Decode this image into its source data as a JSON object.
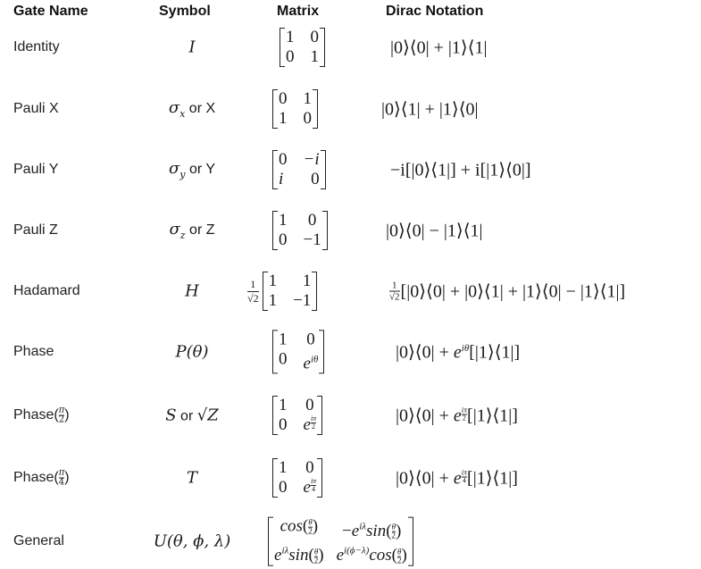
{
  "headers": {
    "gate_name": "Gate Name",
    "symbol": "Symbol",
    "matrix": "Matrix",
    "dirac": "Dirac Notation"
  },
  "gates": [
    {
      "name": "Identity",
      "symbol": "I",
      "matrix": [
        [
          "1",
          "0"
        ],
        [
          "0",
          "1"
        ]
      ],
      "dirac": "|0⟩⟨0| + |1⟩⟨1|"
    },
    {
      "name": "Pauli X",
      "symbol_math": "σₓ",
      "symbol_text": " or X",
      "matrix": [
        [
          "0",
          "1"
        ],
        [
          "1",
          "0"
        ]
      ],
      "dirac": "|0⟩⟨1| + |1⟩⟨0|"
    },
    {
      "name": "Pauli Y",
      "symbol_math": "σᵧ",
      "symbol_text": " or Y",
      "matrix": [
        [
          "0",
          "−i"
        ],
        [
          "i",
          "0"
        ]
      ],
      "dirac": "−i[|0⟩⟨1|] + i[|1⟩⟨0|]"
    },
    {
      "name": "Pauli Z",
      "symbol_math": "σ_z",
      "symbol_text": " or Z",
      "matrix": [
        [
          "1",
          "0"
        ],
        [
          "0",
          "−1"
        ]
      ],
      "dirac": "|0⟩⟨0| − |1⟩⟨1|"
    },
    {
      "name": "Hadamard",
      "symbol": "H",
      "matrix_prefactor": "1/√2",
      "matrix": [
        [
          "1",
          "1"
        ],
        [
          "1",
          "−1"
        ]
      ],
      "dirac_prefactor": "1/√2",
      "dirac": "[|0⟩⟨0| + |0⟩⟨1| + |1⟩⟨0| − |1⟩⟨1|]"
    },
    {
      "name": "Phase",
      "symbol": "P(θ)",
      "matrix": [
        [
          "1",
          "0"
        ],
        [
          "0",
          "e^{iθ}"
        ]
      ],
      "dirac": "|0⟩⟨0| + e^{iθ}[|1⟩⟨1|]"
    },
    {
      "name": "Phase(π/2)",
      "symbol_math": "S",
      "symbol_text": " or ",
      "symbol_math2": "√Z",
      "matrix": [
        [
          "1",
          "0"
        ],
        [
          "0",
          "e^{iπ/2}"
        ]
      ],
      "dirac": "|0⟩⟨0| + e^{iπ/2}[|1⟩⟨1|]"
    },
    {
      "name": "Phase(π/4)",
      "symbol": "T",
      "matrix": [
        [
          "1",
          "0"
        ],
        [
          "0",
          "e^{iπ/4}"
        ]
      ],
      "dirac": "|0⟩⟨0| + e^{iπ/4}[|1⟩⟨1|]"
    },
    {
      "name": "General",
      "symbol": "U(θ, ϕ, λ)",
      "matrix": [
        [
          "cos(θ/2)",
          "−e^{iλ}sin(θ/2)"
        ],
        [
          "e^{iλ}sin(θ/2)",
          "e^{i(ϕ−λ)}cos(θ/2)"
        ]
      ],
      "dirac": ""
    }
  ],
  "display": {
    "r0": {
      "name": "Identity",
      "sym": "I",
      "m": [
        "1",
        "0",
        "0",
        "1"
      ],
      "dirac": "|0⟩⟨0| + |1⟩⟨1|"
    },
    "r1": {
      "name": "Pauli X",
      "sym_base": "σ",
      "sym_sub": "x",
      "sym_txt": " or X",
      "m": [
        "0",
        "1",
        "1",
        "0"
      ],
      "dirac": "|0⟩⟨1| + |1⟩⟨0|"
    },
    "r2": {
      "name": "Pauli Y",
      "sym_base": "σ",
      "sym_sub": "y",
      "sym_txt": " or Y",
      "m": [
        "0",
        "−i",
        "i",
        "0"
      ],
      "dirac": "−i[|0⟩⟨1|] + i[|1⟩⟨0|]"
    },
    "r3": {
      "name": "Pauli Z",
      "sym_base": "σ",
      "sym_sub": "z",
      "sym_txt": " or Z",
      "m": [
        "1",
        "0",
        "0",
        "−1"
      ],
      "dirac": "|0⟩⟨0| − |1⟩⟨1|"
    },
    "r4": {
      "name": "Hadamard",
      "sym": "H",
      "pre_num": "1",
      "pre_den": "√2",
      "m": [
        "1",
        "1",
        "1",
        "−1"
      ],
      "dirac": "[|0⟩⟨0| + |0⟩⟨1| + |1⟩⟨0| − |1⟩⟨1|]"
    },
    "r5": {
      "name": "Phase",
      "sym": "P(θ)",
      "m": [
        "1",
        "0",
        "0"
      ],
      "e": "e",
      "e_sup": "iθ",
      "dirac_a": "|0⟩⟨0| + ",
      "dirac_b": "[|1⟩⟨1|]"
    },
    "r6": {
      "name_a": "Phase(",
      "name_num": "π",
      "name_den": "2",
      "name_b": ")",
      "sym_a": "S",
      "sym_txt": " or ",
      "sym_b": "√Z",
      "m": [
        "1",
        "0",
        "0"
      ],
      "e": "e",
      "e_num": "iπ",
      "e_den": "2",
      "dirac_a": "|0⟩⟨0| + ",
      "dirac_b": "[|1⟩⟨1|]"
    },
    "r7": {
      "name_a": "Phase(",
      "name_num": "π",
      "name_den": "4",
      "name_b": ")",
      "sym": "T",
      "m": [
        "1",
        "0",
        "0"
      ],
      "e": "e",
      "e_num": "iπ",
      "e_den": "4",
      "dirac_a": "|0⟩⟨0| + ",
      "dirac_b": "[|1⟩⟨1|]"
    },
    "r8": {
      "name": "General",
      "sym": "U(θ, ϕ, λ)",
      "cos": "cos",
      "sin": "sin",
      "neg": "−",
      "e": "e",
      "sup_il": "iλ",
      "sup_iphl": "i(ϕ−λ)",
      "theta": "θ",
      "two": "2",
      "lp": "(",
      "rp": ")"
    }
  }
}
